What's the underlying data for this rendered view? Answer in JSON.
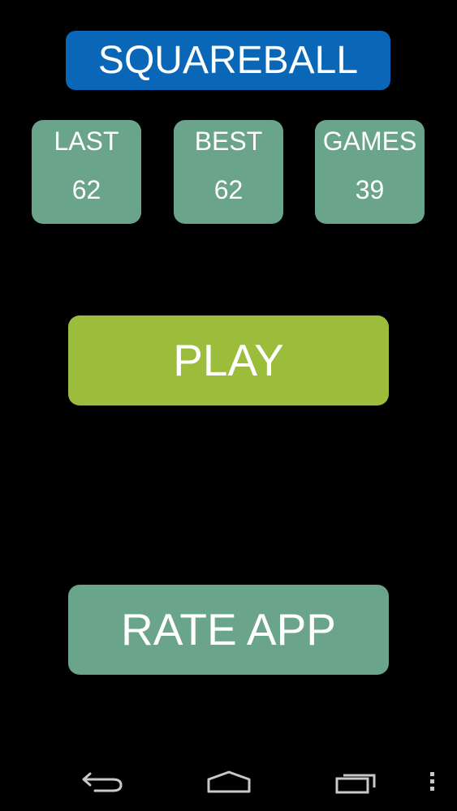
{
  "app": {
    "title": "SQUAREBALL"
  },
  "stats": [
    {
      "label": "LAST",
      "value": "62"
    },
    {
      "label": "BEST",
      "value": "62"
    },
    {
      "label": "GAMES",
      "value": "39"
    }
  ],
  "buttons": {
    "play_label": "PLAY",
    "rate_label": "RATE APP"
  },
  "colors": {
    "background": "#000000",
    "title_bg": "#0a67b8",
    "stat_bg": "#6aa48a",
    "play_bg": "#9cbc3c",
    "rate_bg": "#6aa48a",
    "text": "#ffffff",
    "nav_icon": "#c8c8c8"
  },
  "nav": {
    "back_icon": "back-arrow-icon",
    "home_icon": "home-icon",
    "recents_icon": "recent-apps-icon",
    "menu_icon": "overflow-menu-icon"
  }
}
